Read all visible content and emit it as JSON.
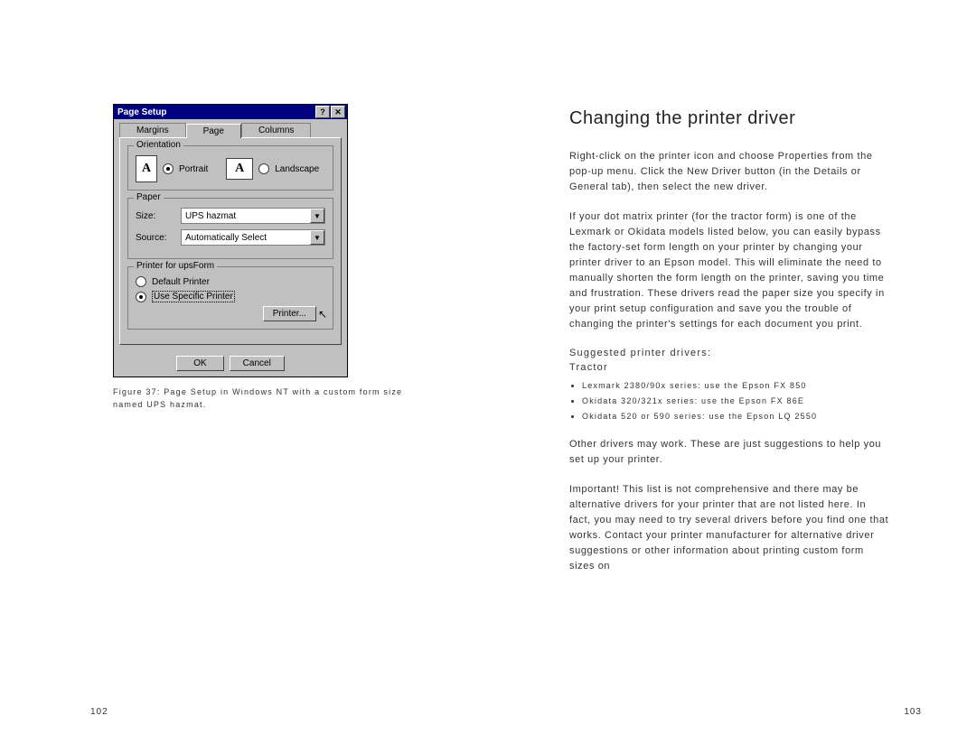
{
  "dialog": {
    "title": "Page Setup",
    "help": "?",
    "close": "✕",
    "tabs": {
      "margins": "Margins",
      "page": "Page",
      "columns": "Columns"
    },
    "orientation": {
      "legend": "Orientation",
      "portrait_icon": "A",
      "portrait": "Portrait",
      "landscape_icon": "A",
      "landscape": "Landscape"
    },
    "paper": {
      "legend": "Paper",
      "size_label": "Size:",
      "size_value": "UPS hazmat",
      "source_label": "Source:",
      "source_value": "Automatically Select"
    },
    "printer_for": {
      "legend": "Printer for upsForm",
      "default": "Default Printer",
      "specific": "Use Specific Printer",
      "printer_btn": "Printer..."
    },
    "ok": "OK",
    "cancel": "Cancel"
  },
  "caption": "Figure 37: Page Setup in Windows NT with a custom form size named UPS hazmat.",
  "right": {
    "heading": "Changing the printer driver",
    "p1": "Right-click on the printer icon and choose Properties from the pop-up menu. Click the New Driver button (in the Details or General tab), then select the new driver.",
    "p2": "If your dot matrix printer (for the tractor form) is one of the Lexmark or Okidata models listed below, you can easily bypass the factory-set form length on your printer by changing your printer driver to an Epson model. This will eliminate the need to manually shorten the form length on the printer, saving you time and frustration. These drivers read the paper size you specify in your print setup configuration and save you the trouble of changing the printer's settings for each document you print.",
    "sub1": "Suggested printer drivers:",
    "sub2": "Tractor",
    "li1": "Lexmark 2380/90x series: use the Epson FX 850",
    "li2": "Okidata 320/321x series: use the Epson FX 86E",
    "li3": "Okidata 520 or 590 series: use the Epson LQ 2550",
    "p3": "Other drivers may work. These are just suggestions to help you set up your printer.",
    "p4": "Important! This list is not comprehensive and there may be alternative drivers for your printer that are not listed here. In fact, you may need to try several drivers before you find one that works. Contact your printer manufacturer for alternative driver suggestions or other information about printing custom form sizes on"
  },
  "page_left": "102",
  "page_right": "103"
}
